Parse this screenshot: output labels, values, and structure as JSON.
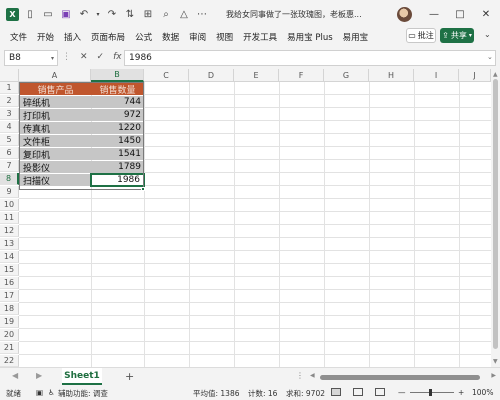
{
  "titlebar": {
    "app_icon": "X",
    "doc_title": "我给女同事做了一张玫瑰图，老板惠...",
    "icons": [
      "excel-app-icon",
      "new-file-icon",
      "open-folder-icon",
      "save-icon",
      "undo-icon",
      "redo-icon",
      "sort-icon",
      "border-icon",
      "search-icon",
      "shapes-icon",
      "more-icon"
    ],
    "window_buttons": [
      "—",
      "□",
      "✕"
    ]
  },
  "menu": {
    "tabs": [
      "文件",
      "开始",
      "插入",
      "页面布局",
      "公式",
      "数据",
      "审阅",
      "视图",
      "开发工具",
      "易用宝 Plus",
      "易用宝"
    ],
    "comment_label": "批注",
    "share_label": "共享"
  },
  "formula": {
    "namebox": "B8",
    "fx": "fx",
    "cancel": "✕",
    "confirm": "✓",
    "value": "1986"
  },
  "grid": {
    "columns": [
      "A",
      "B",
      "C",
      "D",
      "E",
      "F",
      "G",
      "H",
      "I",
      "J"
    ],
    "rows": [
      "1",
      "2",
      "3",
      "4",
      "5",
      "6",
      "7",
      "8",
      "9",
      "10",
      "11",
      "12",
      "13",
      "14",
      "15",
      "16",
      "17",
      "18",
      "19",
      "20",
      "21",
      "22"
    ],
    "header": [
      "销售产品",
      "销售数量"
    ],
    "data": [
      [
        "碎纸机",
        "744"
      ],
      [
        "打印机",
        "972"
      ],
      [
        "传真机",
        "1220"
      ],
      [
        "文件柜",
        "1450"
      ],
      [
        "复印机",
        "1541"
      ],
      [
        "投影仪",
        "1789"
      ],
      [
        "扫描仪",
        "1986"
      ]
    ],
    "active_cell": "B8",
    "header_color": "#c0562d"
  },
  "sheets": {
    "tabs": [
      "Sheet1"
    ],
    "add": "+",
    "more": "⋮"
  },
  "status": {
    "ready": "就绪",
    "accessibility": "辅助功能: 调查",
    "average": "平均值: 1386",
    "count": "计数: 16",
    "sum": "求和: 9702",
    "zoom_minus": "—",
    "zoom_plus": "+",
    "zoom": "100%"
  }
}
